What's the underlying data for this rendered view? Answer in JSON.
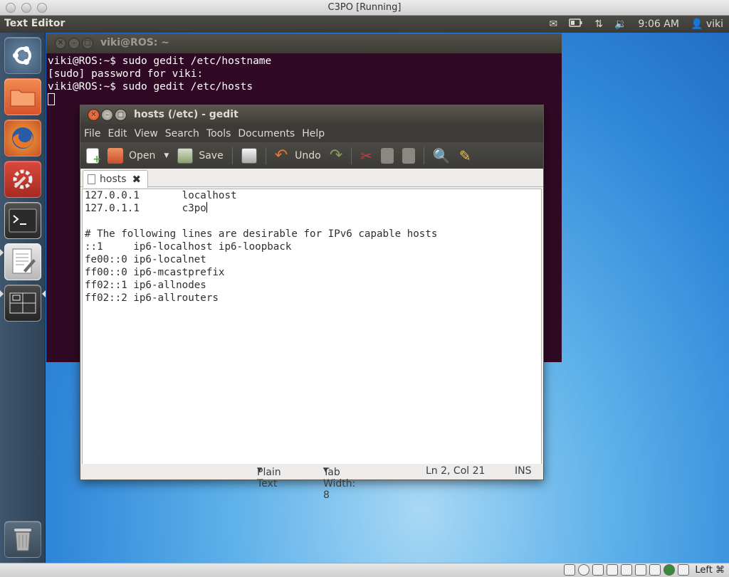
{
  "host": {
    "window_title": "C3PO [Running]",
    "host_key": "Left ⌘"
  },
  "panel": {
    "app_title": "Text Editor",
    "time": "9:06 AM",
    "user": "viki"
  },
  "terminal": {
    "title": "viki@ROS: ~",
    "lines": [
      "viki@ROS:~$ sudo gedit /etc/hostname",
      "[sudo] password for viki:",
      "viki@ROS:~$ sudo gedit /etc/hosts"
    ]
  },
  "gedit": {
    "title": "hosts (/etc) - gedit",
    "menu": [
      "File",
      "Edit",
      "View",
      "Search",
      "Tools",
      "Documents",
      "Help"
    ],
    "toolbar": {
      "open_label": "Open",
      "save_label": "Save",
      "undo_label": "Undo"
    },
    "tab": {
      "label": "hosts"
    },
    "lines": [
      "127.0.0.1\tlocalhost",
      "127.0.1.1\tc3po",
      "",
      "# The following lines are desirable for IPv6 capable hosts",
      "::1     ip6-localhost ip6-loopback",
      "fe00::0 ip6-localnet",
      "ff00::0 ip6-mcastprefix",
      "ff02::1 ip6-allnodes",
      "ff02::2 ip6-allrouters"
    ],
    "status": {
      "language": "Plain Text",
      "tab_width": "Tab Width:  8",
      "position": "Ln 2, Col 21",
      "mode": "INS"
    }
  },
  "colors": {
    "terminal_bg": "#300a24",
    "panel_bg": "#3c3b37",
    "launcher_bg": "#34495e",
    "desktop_bg": "#4aa0e6",
    "accent_orange": "#e0552f"
  }
}
